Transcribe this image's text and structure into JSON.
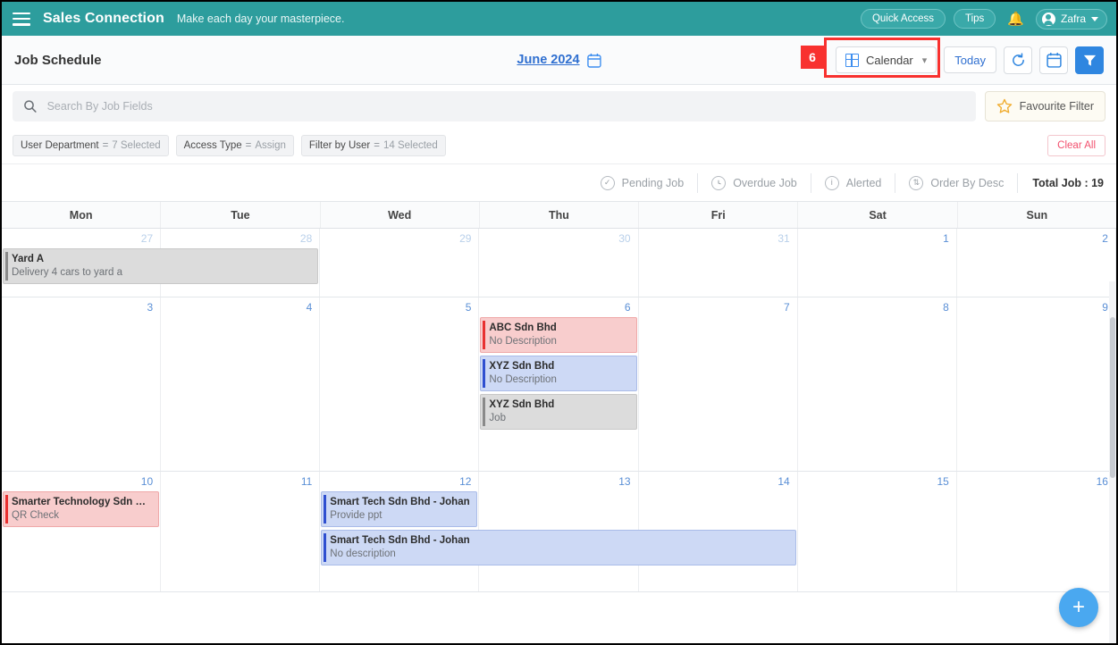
{
  "topbar": {
    "menu_icon": "hamburger-icon",
    "brand": "Sales Connection",
    "tagline": "Make each day your masterpiece.",
    "quick_access": "Quick Access",
    "tips": "Tips",
    "bell_icon": "bell-icon",
    "user_name": "Zafra",
    "teal": "#2d9d9d"
  },
  "toolbar": {
    "page_title": "Job Schedule",
    "month": "June 2024",
    "month_calendar_icon": "calendar-icon",
    "badge_number": "6",
    "view_select": "Calendar",
    "view_icon": "grid-icon",
    "today": "Today",
    "refresh_icon": "refresh-icon",
    "date_picker_icon": "calendar-icon",
    "filter_icon": "funnel-icon",
    "highlight_color": "#f8312f",
    "accent": "#2f86e0"
  },
  "search": {
    "icon": "search-icon",
    "placeholder": "Search By Job Fields",
    "value": "",
    "favourite_filter": "Favourite Filter",
    "star_icon": "star-icon"
  },
  "filters": {
    "chips": [
      {
        "label": "User Department",
        "eq": "=",
        "value": "7 Selected"
      },
      {
        "label": "Access Type",
        "eq": "=",
        "value": "Assign"
      },
      {
        "label": "Filter by User",
        "eq": "=",
        "value": "14 Selected"
      }
    ],
    "clear_all": "Clear All"
  },
  "legend": {
    "items": [
      {
        "label": "Pending Job",
        "icon": "check-circle-icon",
        "glyph": "✓"
      },
      {
        "label": "Overdue Job",
        "icon": "clock-icon",
        "glyph": "◴"
      },
      {
        "label": "Alerted",
        "icon": "info-icon",
        "glyph": "i"
      },
      {
        "label": "Order By Desc",
        "icon": "sort-icon",
        "glyph": "⇅"
      }
    ],
    "total_label": "Total Job :",
    "total_value": "19"
  },
  "calendar": {
    "day_names": [
      "Mon",
      "Tue",
      "Wed",
      "Thu",
      "Fri",
      "Sat",
      "Sun"
    ],
    "weeks": [
      {
        "days": [
          {
            "num": "27",
            "muted": true
          },
          {
            "num": "28",
            "muted": true
          },
          {
            "num": "29",
            "muted": true
          },
          {
            "num": "30",
            "muted": true
          },
          {
            "num": "31",
            "muted": true
          },
          {
            "num": "1",
            "muted": false
          },
          {
            "num": "2",
            "muted": false
          }
        ],
        "events": [
          {
            "title": "Yard A",
            "desc": "Delivery 4 cars to yard a",
            "color": "gray",
            "start": 0,
            "span": 2,
            "row": 0
          }
        ]
      },
      {
        "days": [
          {
            "num": "3",
            "muted": false
          },
          {
            "num": "4",
            "muted": false
          },
          {
            "num": "5",
            "muted": false
          },
          {
            "num": "6",
            "muted": false
          },
          {
            "num": "7",
            "muted": false
          },
          {
            "num": "8",
            "muted": false
          },
          {
            "num": "9",
            "muted": false
          }
        ],
        "events": [
          {
            "title": "ABC Sdn Bhd",
            "desc": "No Description",
            "color": "red",
            "start": 3,
            "span": 1,
            "row": 0
          },
          {
            "title": "XYZ Sdn Bhd",
            "desc": "No Description",
            "color": "blue",
            "start": 3,
            "span": 1,
            "row": 1
          },
          {
            "title": "XYZ Sdn Bhd",
            "desc": "Job",
            "color": "gray",
            "start": 3,
            "span": 1,
            "row": 2
          }
        ]
      },
      {
        "days": [
          {
            "num": "10",
            "muted": false
          },
          {
            "num": "11",
            "muted": false
          },
          {
            "num": "12",
            "muted": false
          },
          {
            "num": "13",
            "muted": false
          },
          {
            "num": "14",
            "muted": false
          },
          {
            "num": "15",
            "muted": false
          },
          {
            "num": "16",
            "muted": false
          }
        ],
        "events": [
          {
            "title": "Smarter Technology Sdn Bh...",
            "desc": "QR Check",
            "color": "red",
            "start": 0,
            "span": 1,
            "row": 0
          },
          {
            "title": "Smart Tech Sdn Bhd - Johan",
            "desc": "Provide ppt",
            "color": "blue",
            "start": 2,
            "span": 1,
            "row": 0
          },
          {
            "title": "Smart Tech Sdn Bhd - Johan",
            "desc": "No description",
            "color": "blue",
            "start": 2,
            "span": 3,
            "row": 1
          }
        ]
      }
    ]
  },
  "fab": {
    "label": "+",
    "icon": "plus-icon",
    "color": "#4aa8f0"
  }
}
